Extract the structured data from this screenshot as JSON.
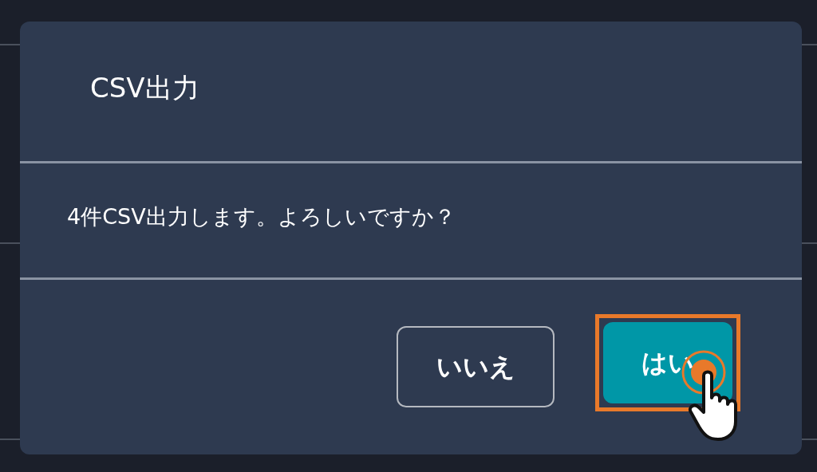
{
  "dialog": {
    "title": "CSV出力",
    "message": "4件CSV出力します。よろしいですか？",
    "buttons": [
      {
        "label": "いいえ",
        "kind": "secondary",
        "highlighted": false
      },
      {
        "label": "はい",
        "kind": "primary",
        "highlighted": true
      }
    ]
  }
}
